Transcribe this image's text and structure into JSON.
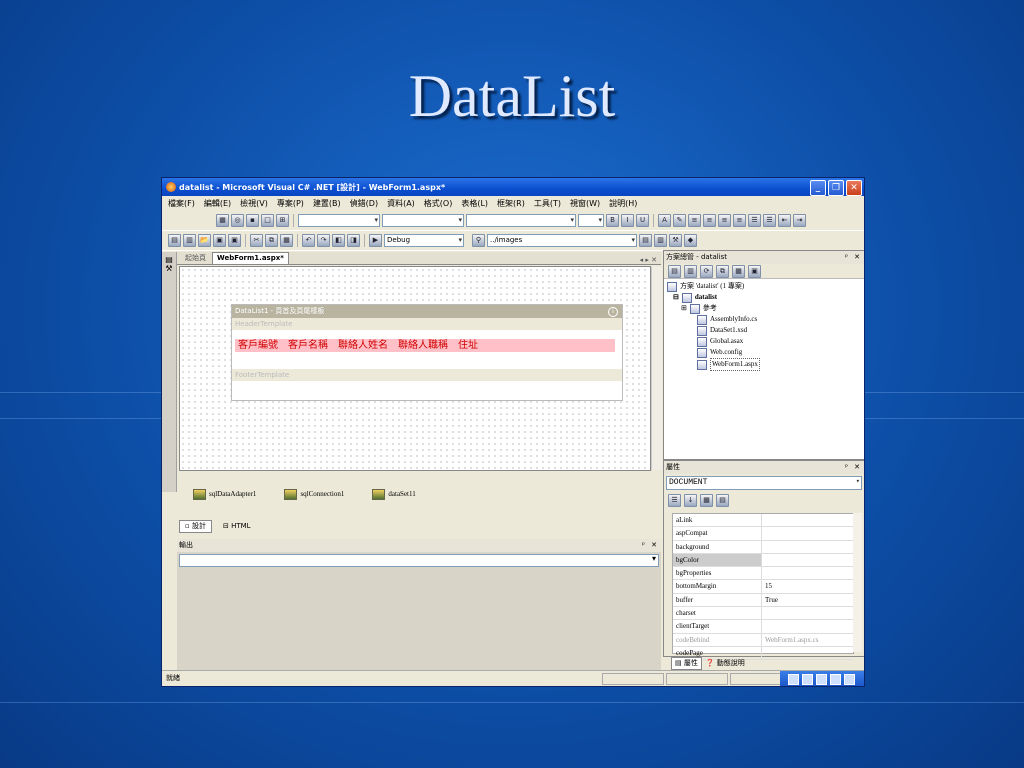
{
  "slide": {
    "title": "DataList"
  },
  "window": {
    "title": "datalist - Microsoft Visual C# .NET [設計] - WebForm1.aspx*",
    "menu": [
      "檔案(F)",
      "編輯(E)",
      "檢視(V)",
      "專案(P)",
      "建置(B)",
      "偵錯(D)",
      "資料(A)",
      "格式(O)",
      "表格(L)",
      "框架(R)",
      "工具(T)",
      "視窗(W)",
      "說明(H)"
    ],
    "toolbar": {
      "config": "Debug",
      "images_path": "../images"
    }
  },
  "editor": {
    "tabs": [
      "起始頁",
      "WebForm1.aspx*"
    ],
    "datalist": {
      "header_title": "DataList1 - 頁首及頁尾樣板",
      "header_template": "HeaderTemplate",
      "footer_template": "FooterTemplate",
      "columns": [
        "客戶編號",
        "客戶名稱",
        "聯絡人姓名",
        "聯絡人職稱",
        "住址"
      ]
    },
    "components": [
      "sqlDataAdapter1",
      "sqlConnection1",
      "dataSet11"
    ],
    "view_tabs": [
      "設計",
      "HTML"
    ]
  },
  "output_panel": {
    "title": "輸出"
  },
  "solution_explorer": {
    "title": "方案總管 - datalist",
    "solution": "方案 'datalist' (1 專案)",
    "project": "datalist",
    "items": [
      "參考",
      "AssemblyInfo.cs",
      "DataSet1.xsd",
      "Global.asax",
      "Web.config",
      "WebForm1.aspx"
    ]
  },
  "properties": {
    "title": "屬性",
    "object": "DOCUMENT",
    "rows": [
      {
        "k": "aLink",
        "v": ""
      },
      {
        "k": "aspCompat",
        "v": ""
      },
      {
        "k": "background",
        "v": ""
      },
      {
        "k": "bgColor",
        "v": ""
      },
      {
        "k": "bgProperties",
        "v": ""
      },
      {
        "k": "bottomMargin",
        "v": "15"
      },
      {
        "k": "buffer",
        "v": "True"
      },
      {
        "k": "charset",
        "v": ""
      },
      {
        "k": "clientTarget",
        "v": ""
      },
      {
        "k": "codeBehind",
        "v": "WebForm1.aspx.cs"
      },
      {
        "k": "codePage",
        "v": ""
      }
    ],
    "bottom_tabs": [
      "屬性",
      "動態說明"
    ]
  },
  "status": {
    "text": "就緒"
  }
}
